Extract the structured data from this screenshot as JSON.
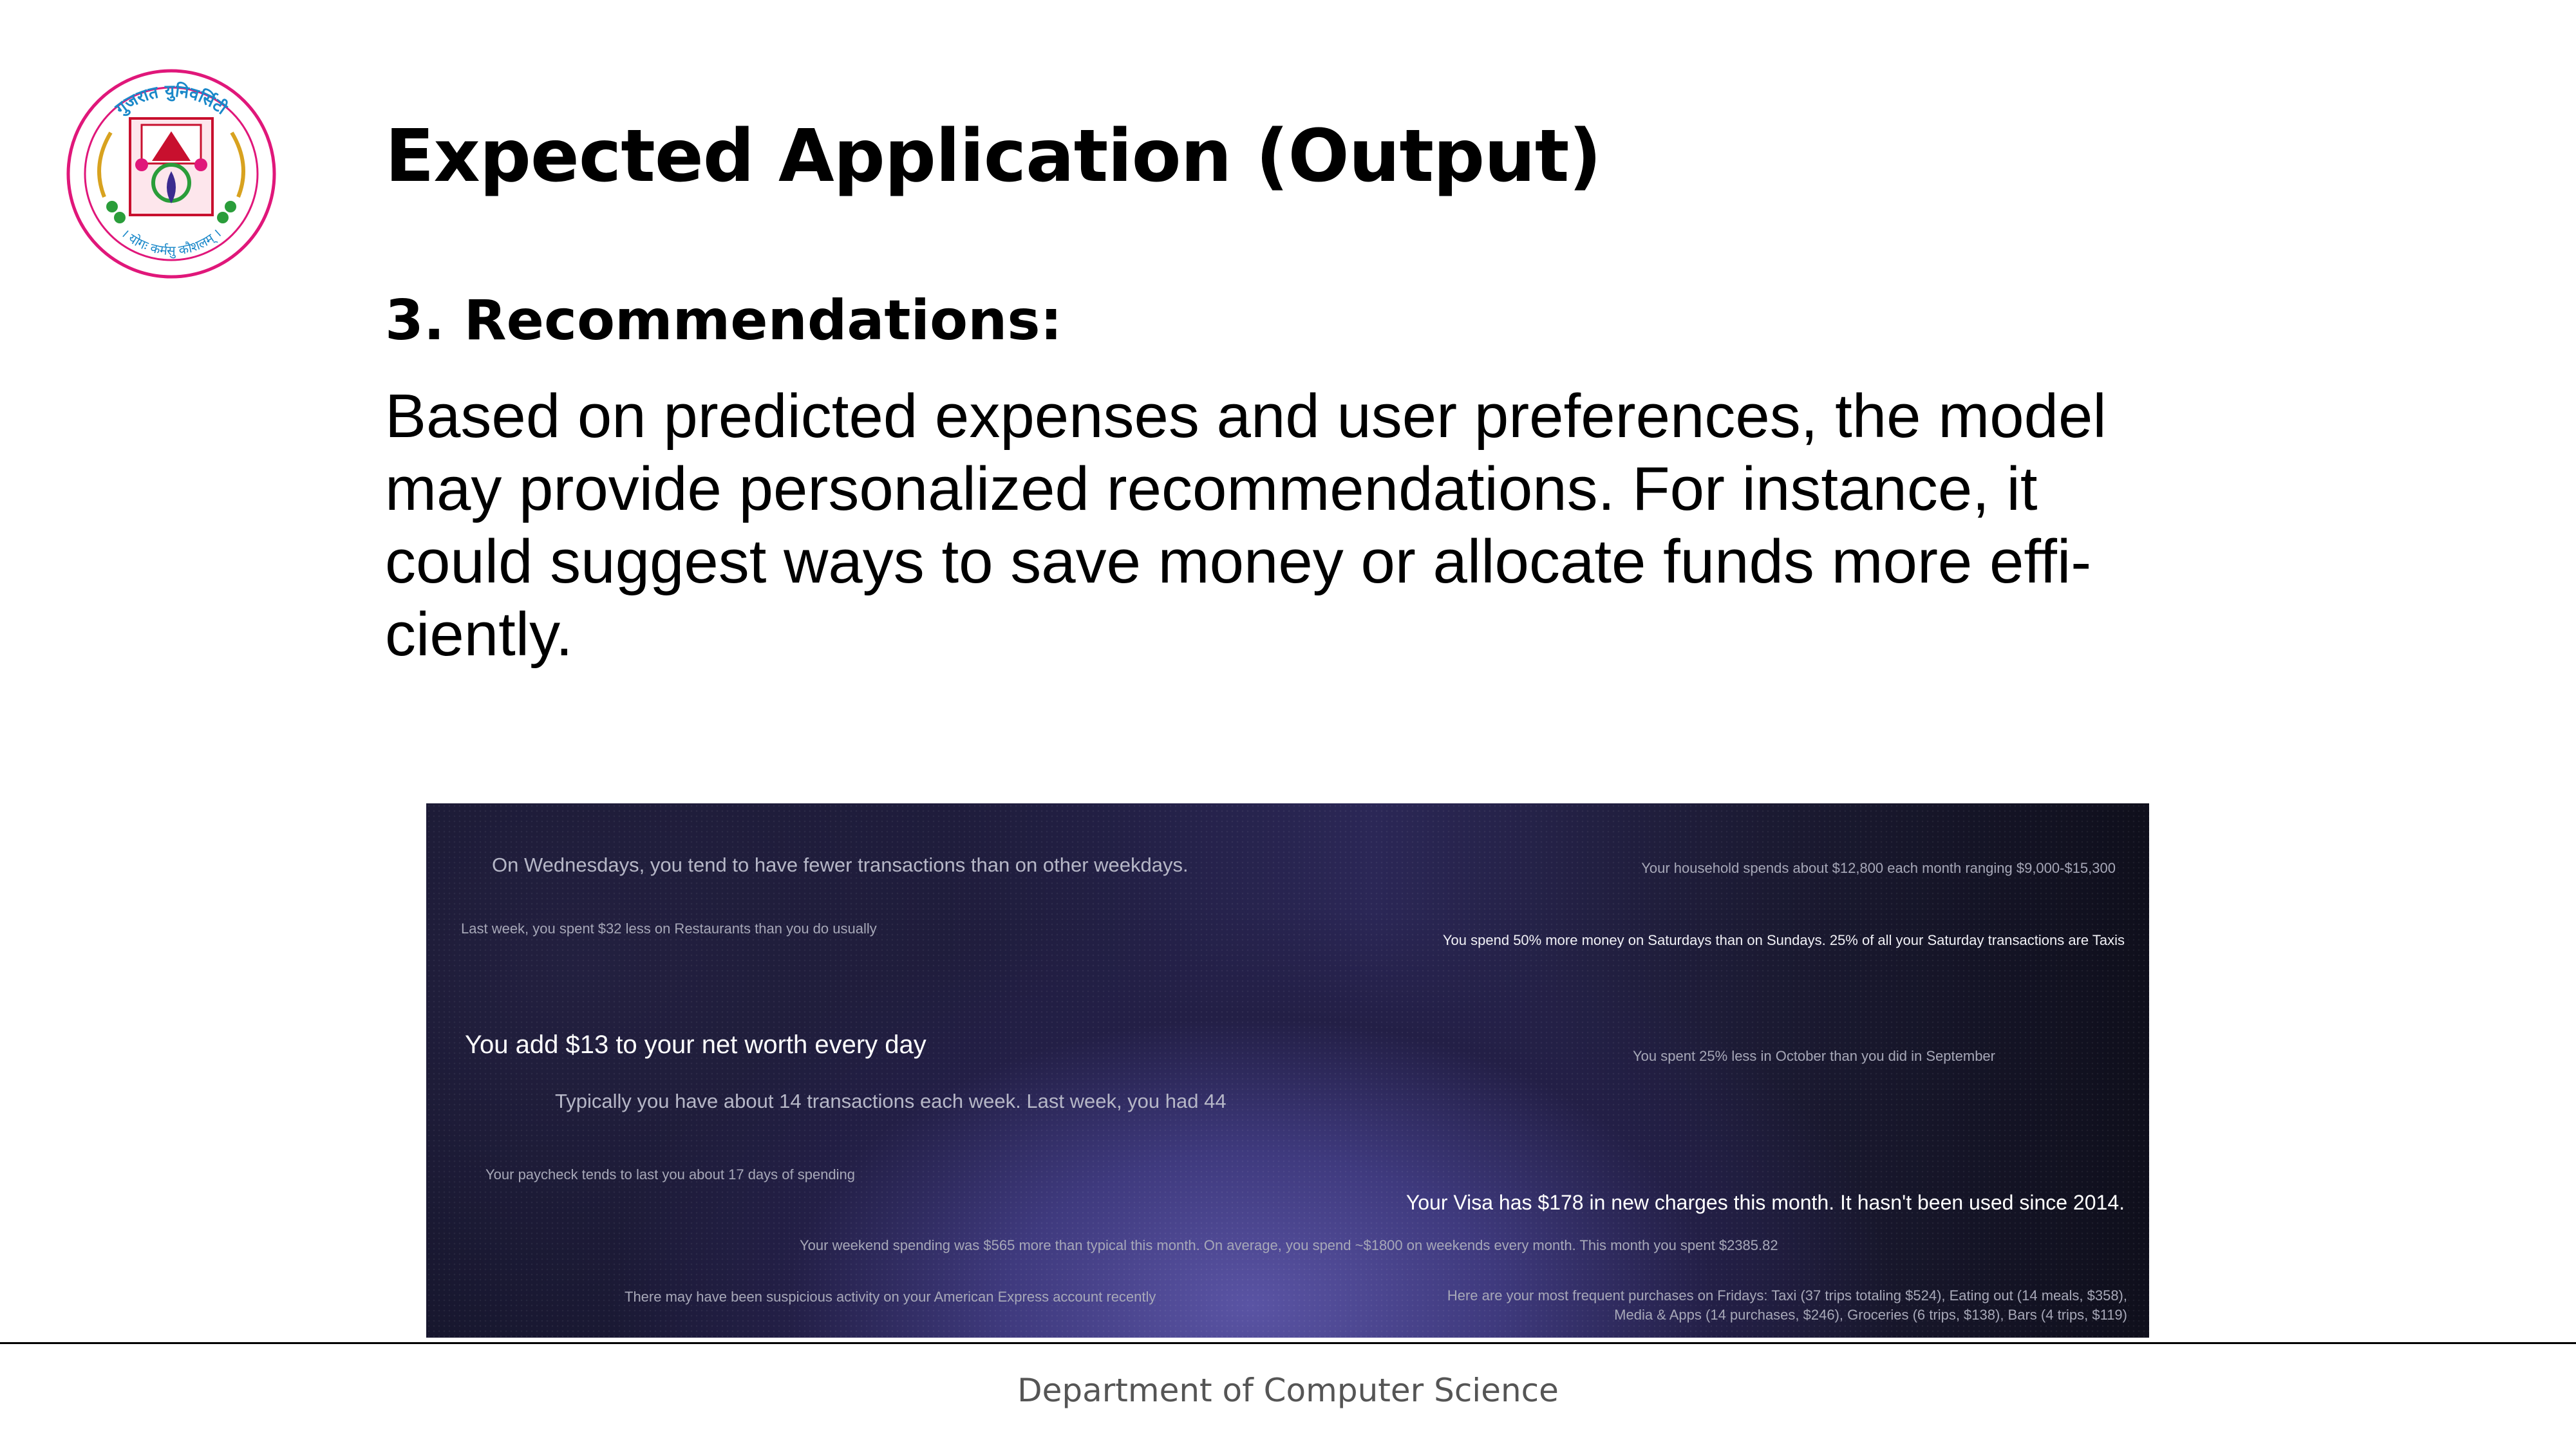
{
  "logo": {
    "top_arc_text": "गुजरात युनिवर्सिटी",
    "bottom_arc_text": "। योगः कर्मसु कौशलम् ।",
    "colors": {
      "ring": "#e0177a",
      "inner": "#c8102e",
      "leaf": "#2a9d3a",
      "gold": "#d8a21f",
      "peacock": "#3b2b8f"
    }
  },
  "slide": {
    "title": "Expected Application (Output)",
    "subheading": "3. Recommendations:",
    "body_lines": [
      "Based on predicted expenses and user preferences, the model",
      "may provide personalized recommendations. For instance, it",
      "could suggest ways to save money or allocate funds more effi-",
      "ciently."
    ]
  },
  "insights": [
    "On Wednesdays, you tend to have fewer transactions than on other weekdays.",
    "Your household spends about $12,800 each month ranging $9,000-$15,300",
    "Last week, you spent $32 less on Restaurants than you do usually",
    "You spend 50% more money on Saturdays than on Sundays. 25% of all your Saturday transactions are Taxis",
    "You add $13 to your net worth every day",
    "You spent 25% less in October than you did in September",
    "Typically you have about 14 transactions each week. Last week, you had 44",
    "Your paycheck tends to last you about 17 days of spending",
    "Your Visa has $178 in new charges this month. It hasn't been used since 2014.",
    "Your weekend spending was $565 more than typical this month. On average, you spend ~$1800 on weekends every month. This month you spent $2385.82",
    "There may have been suspicious activity on your American Express account recently"
  ],
  "friday_purchases": [
    "Here are your most frequent purchases on Fridays: Taxi (37 trips totaling $524), Eating out (14 meals, $358),",
    "Media & Apps (14 purchases, $246), Groceries (6 trips, $138), Bars (4 trips, $119)"
  ],
  "footer": {
    "department": "Department of Computer Science"
  }
}
